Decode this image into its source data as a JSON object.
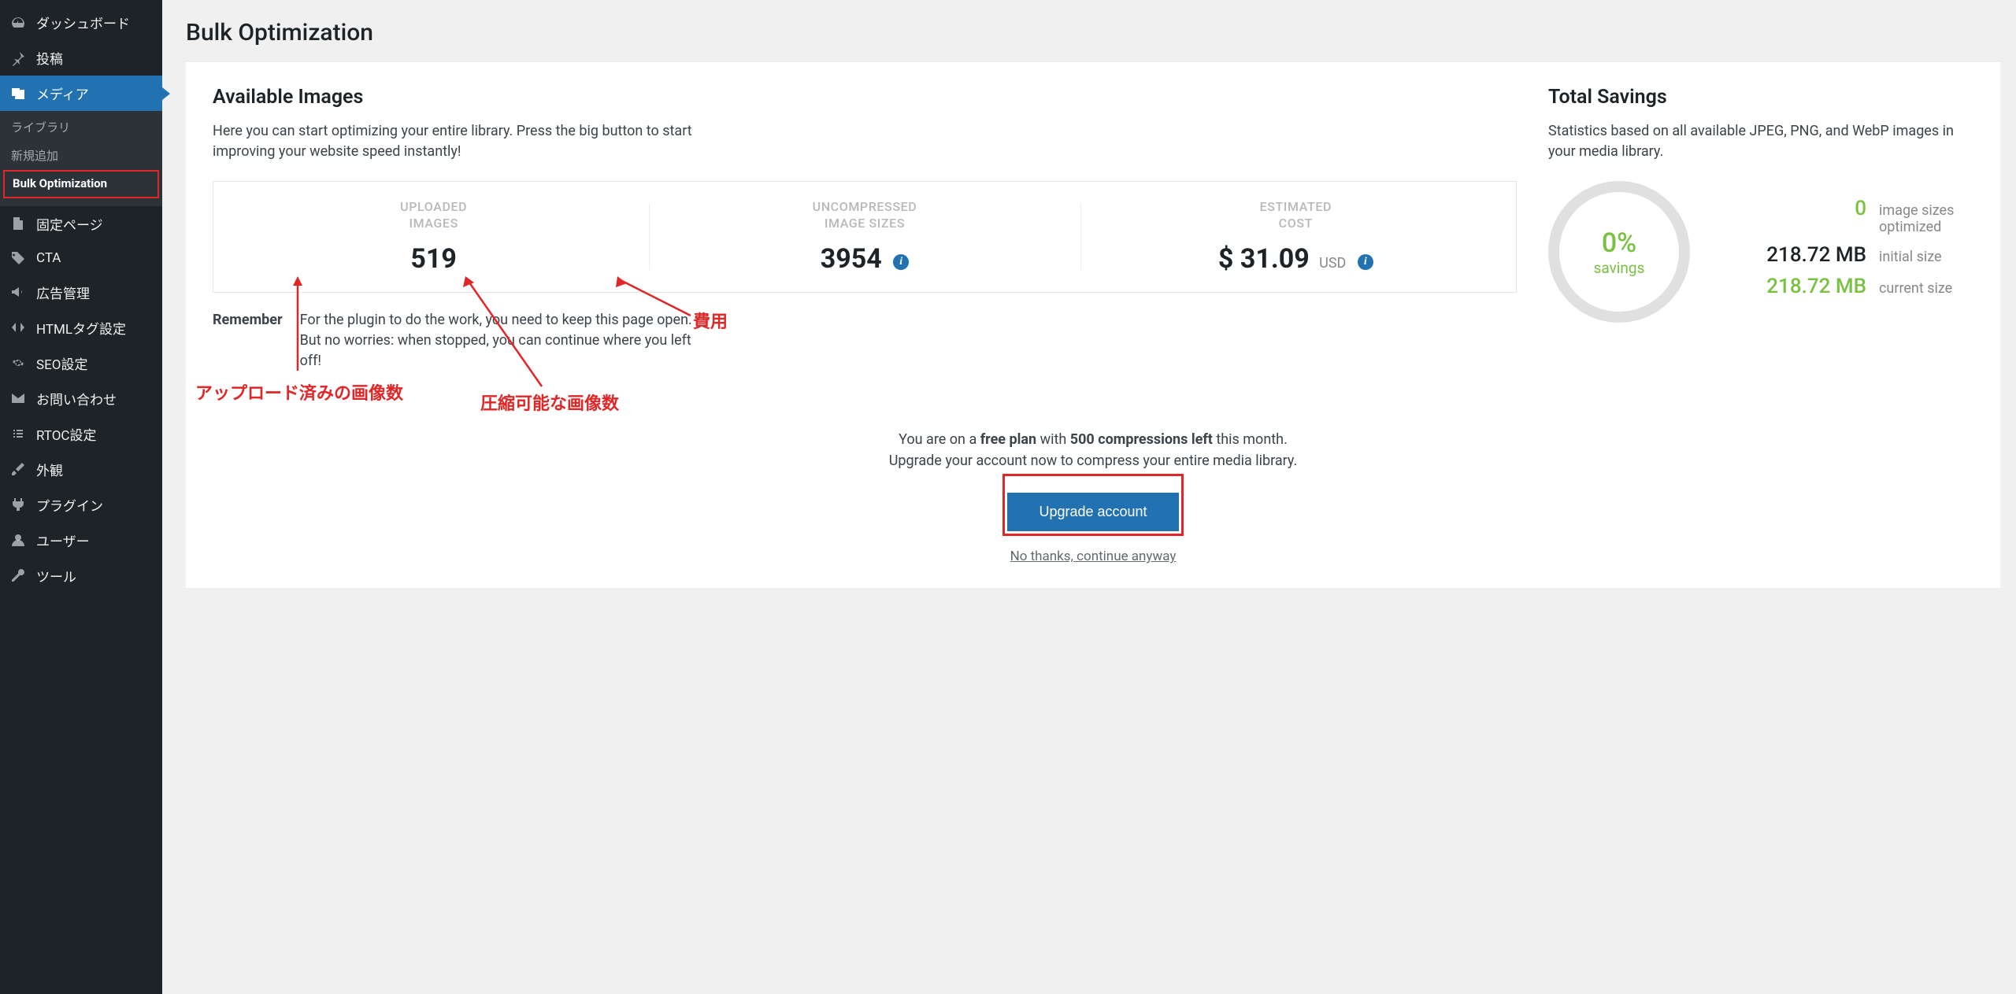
{
  "sidebar": {
    "dashboard_label": "ダッシュボード",
    "posts_label": "投稿",
    "media_label": "メディア",
    "media_sub": {
      "library_label": "ライブラリ",
      "addnew_label": "新規追加",
      "bulkopt_label": "Bulk Optimization"
    },
    "pages_label": "固定ページ",
    "cta_label": "CTA",
    "ads_label": "広告管理",
    "htmltag_label": "HTMLタグ設定",
    "seo_label": "SEO設定",
    "contact_label": "お問い合わせ",
    "rtoc_label": "RTOC設定",
    "appearance_label": "外観",
    "plugins_label": "プラグイン",
    "users_label": "ユーザー",
    "tools_label": "ツール"
  },
  "page": {
    "title": "Bulk Optimization"
  },
  "available": {
    "title": "Available Images",
    "desc": "Here you can start optimizing your entire library. Press the big button to start improving your website speed instantly!",
    "uploaded_label1": "UPLOADED",
    "uploaded_label2": "IMAGES",
    "uploaded_value": "519",
    "uncompressed_label1": "UNCOMPRESSED",
    "uncompressed_label2": "IMAGE SIZES",
    "uncompressed_value": "3954",
    "estimated_label1": "ESTIMATED",
    "estimated_label2": "COST",
    "estimated_symbol": "$",
    "estimated_value": "31.09",
    "estimated_currency": "USD",
    "remember_label": "Remember",
    "remember_text": "For the plugin to do the work, you need to keep this page open. But no worries: when stopped, you can continue where you left off!"
  },
  "savings": {
    "title": "Total Savings",
    "desc": "Statistics based on all available JPEG, PNG, and WebP images in your media library.",
    "percent": "0%",
    "percent_label": "savings",
    "optimized_count": "0",
    "optimized_label": "image sizes optimized",
    "initial_size": "218.72 MB",
    "initial_label": "initial size",
    "current_size": "218.72 MB",
    "current_label": "current size"
  },
  "cta": {
    "line1_a": "You are on a ",
    "line1_b": "free plan",
    "line1_c": " with ",
    "line1_d": "500 compressions left",
    "line1_e": " this month.",
    "line2": "Upgrade your account now to compress your entire media library.",
    "upgrade_button": "Upgrade account",
    "no_thanks": "No thanks, continue anyway"
  },
  "annotations": {
    "cost_label": "費用",
    "uploaded_label": "アップロード済みの画像数",
    "compressible_label": "圧縮可能な画像数"
  }
}
